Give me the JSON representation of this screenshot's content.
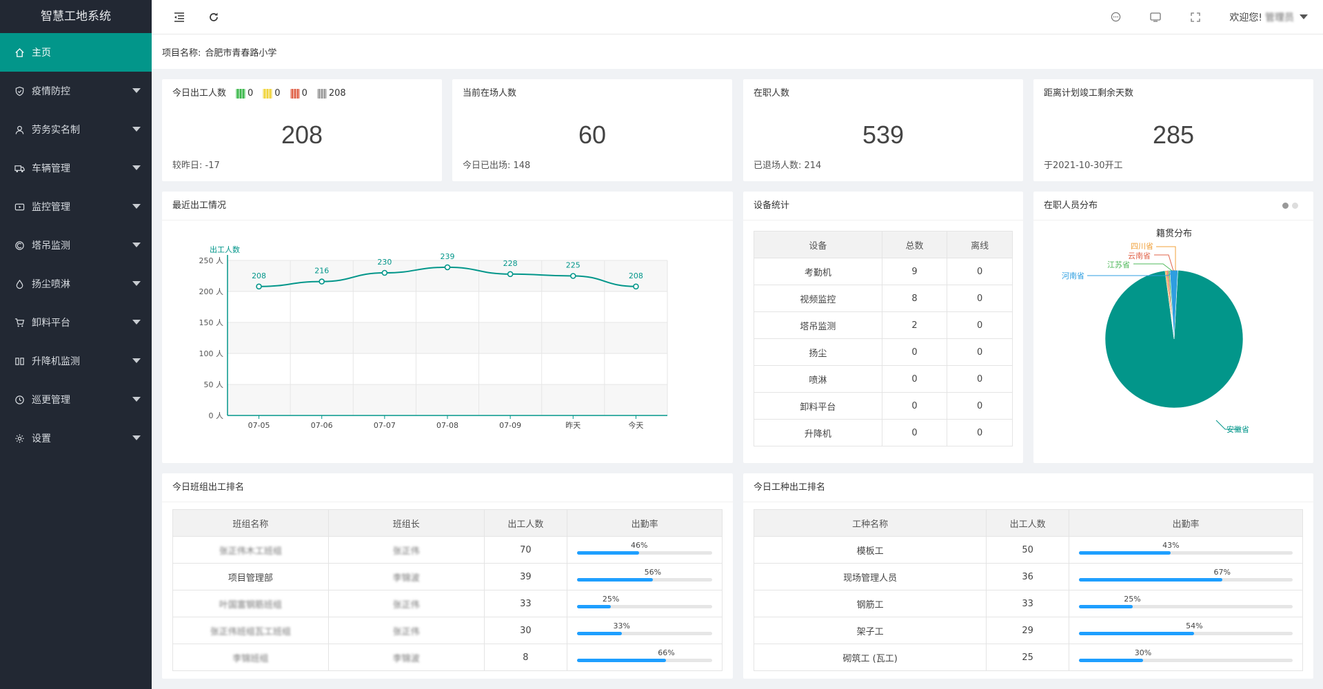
{
  "app": {
    "title": "智慧工地系统"
  },
  "sidebar": {
    "items": [
      {
        "label": "主页",
        "icon": "home-icon",
        "active": true,
        "caret": false
      },
      {
        "label": "疫情防控",
        "icon": "shield-icon",
        "active": false,
        "caret": true
      },
      {
        "label": "劳务实名制",
        "icon": "user-icon",
        "active": false,
        "caret": true
      },
      {
        "label": "车辆管理",
        "icon": "truck-icon",
        "active": false,
        "caret": true
      },
      {
        "label": "监控管理",
        "icon": "video-icon",
        "active": false,
        "caret": true
      },
      {
        "label": "塔吊监测",
        "icon": "crane-icon",
        "active": false,
        "caret": true
      },
      {
        "label": "扬尘喷淋",
        "icon": "spray-icon",
        "active": false,
        "caret": true
      },
      {
        "label": "卸料平台",
        "icon": "cart-icon",
        "active": false,
        "caret": true
      },
      {
        "label": "升降机监测",
        "icon": "elevator-icon",
        "active": false,
        "caret": true
      },
      {
        "label": "巡更管理",
        "icon": "clock-icon",
        "active": false,
        "caret": true
      },
      {
        "label": "设置",
        "icon": "gear-icon",
        "active": false,
        "caret": true
      }
    ]
  },
  "topbar": {
    "welcome": "欢迎您!",
    "username": "管理员"
  },
  "project": {
    "label": "项目名称:",
    "value": "合肥市青春路小学"
  },
  "stats": [
    {
      "title": "今日出工人数",
      "value": "208",
      "sub": "较昨日: -17"
    },
    {
      "title": "当前在场人数",
      "value": "60",
      "sub": "今日已出场: 148"
    },
    {
      "title": "在职人数",
      "value": "539",
      "sub": "已退场人数: 214"
    },
    {
      "title": "距离计划竣工剩余天数",
      "value": "285",
      "sub": "于2021-10-30开工"
    }
  ],
  "health_codes": [
    {
      "color": "#3bb84a",
      "count": "0"
    },
    {
      "color": "#f0d43a",
      "count": "0"
    },
    {
      "color": "#e0634a",
      "count": "0"
    },
    {
      "color": "#9a9a9a",
      "count": "208"
    }
  ],
  "attendance_chart": {
    "title": "最近出工情况",
    "chart_data": {
      "type": "line",
      "categories": [
        "07-05",
        "07-06",
        "07-07",
        "07-08",
        "07-09",
        "昨天",
        "今天"
      ],
      "values": [
        208,
        216,
        230,
        239,
        228,
        225,
        208
      ],
      "ylabel": "出工人数",
      "ylim": [
        0,
        250
      ],
      "yticks": [
        "0 人",
        "50 人",
        "100 人",
        "150 人",
        "200 人",
        "250 人"
      ],
      "color": "#02968a"
    }
  },
  "devices": {
    "title": "设备统计",
    "headers": [
      "设备",
      "总数",
      "离线"
    ],
    "rows": [
      [
        "考勤机",
        "9",
        "0"
      ],
      [
        "视频监控",
        "8",
        "0"
      ],
      [
        "塔吊监测",
        "2",
        "0"
      ],
      [
        "扬尘",
        "0",
        "0"
      ],
      [
        "喷淋",
        "0",
        "0"
      ],
      [
        "卸料平台",
        "0",
        "0"
      ],
      [
        "升降机",
        "0",
        "0"
      ]
    ]
  },
  "distribution": {
    "title": "在职人员分布",
    "chart_data": {
      "type": "pie",
      "title": "籍贯分布",
      "labels": [
        "安徽省",
        "河南省",
        "江苏省",
        "云南省",
        "四川省"
      ],
      "values": [
        523,
        10,
        2,
        2,
        2
      ],
      "colors": [
        "#02968a",
        "#2d9ee0",
        "#4fb85b",
        "#e0634a",
        "#f0a03a"
      ]
    }
  },
  "team_rank": {
    "title": "今日班组出工排名",
    "headers": [
      "班组名称",
      "班组长",
      "出工人数",
      "出勤率"
    ],
    "rows": [
      {
        "name": "张正伟木工班组",
        "leader": "张正伟",
        "count": "70",
        "rate": 46,
        "rate_label": "46%",
        "blur_name": true
      },
      {
        "name": "项目管理部",
        "leader": "李锦波",
        "count": "39",
        "rate": 56,
        "rate_label": "56%",
        "blur_name": false
      },
      {
        "name": "叶国富钢筋班组",
        "leader": "张正伟",
        "count": "33",
        "rate": 25,
        "rate_label": "25%",
        "blur_name": true
      },
      {
        "name": "张正伟班组瓦工班组",
        "leader": "张正伟",
        "count": "30",
        "rate": 33,
        "rate_label": "33%",
        "blur_name": true
      },
      {
        "name": "李锦班组",
        "leader": "李锦波",
        "count": "8",
        "rate": 66,
        "rate_label": "66%",
        "blur_name": true
      }
    ]
  },
  "trade_rank": {
    "title": "今日工种出工排名",
    "headers": [
      "工种名称",
      "出工人数",
      "出勤率"
    ],
    "rows": [
      {
        "name": "模板工",
        "count": "50",
        "rate": 43,
        "rate_label": "43%"
      },
      {
        "name": "现场管理人员",
        "count": "36",
        "rate": 67,
        "rate_label": "67%"
      },
      {
        "name": "钢筋工",
        "count": "33",
        "rate": 25,
        "rate_label": "25%"
      },
      {
        "name": "架子工",
        "count": "29",
        "rate": 54,
        "rate_label": "54%"
      },
      {
        "name": "砌筑工 (瓦工)",
        "count": "25",
        "rate": 30,
        "rate_label": "30%"
      }
    ]
  }
}
